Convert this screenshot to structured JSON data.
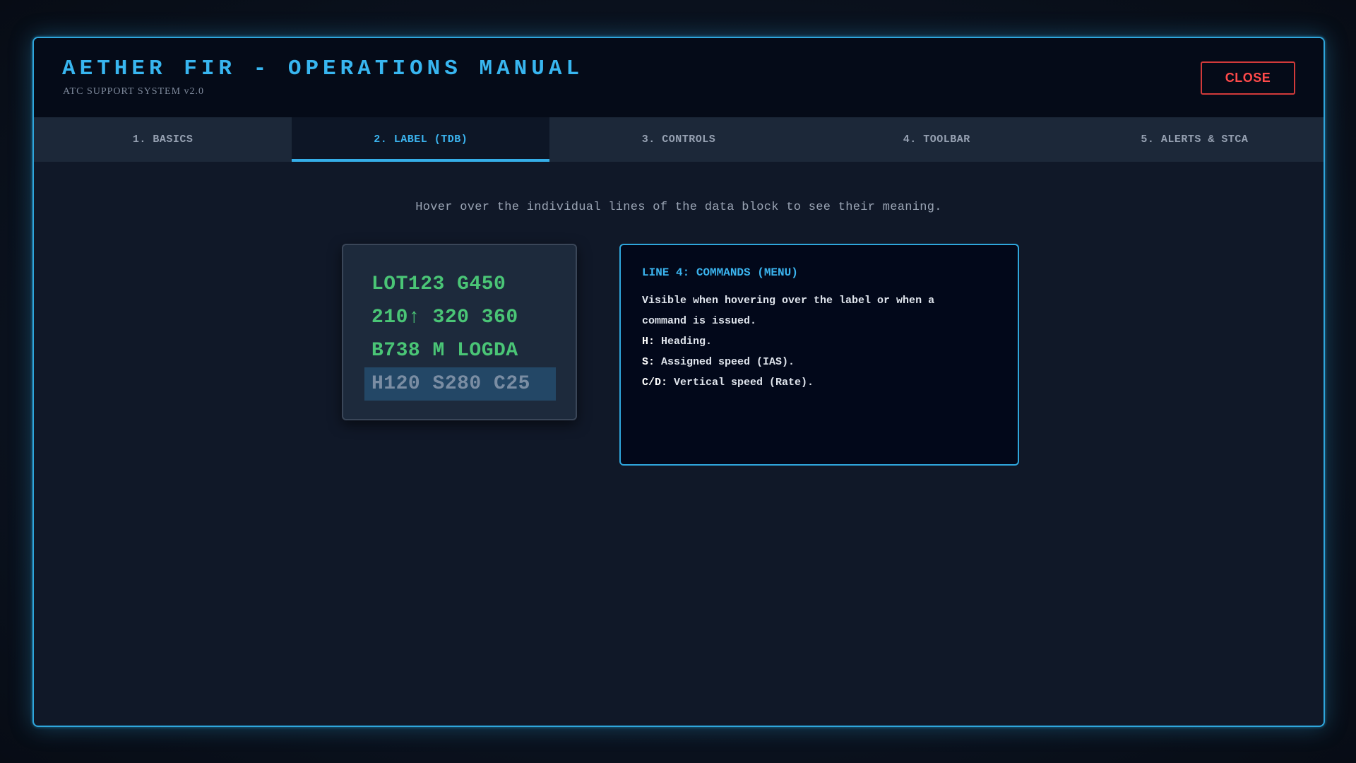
{
  "header": {
    "title": "AETHER FIR - OPERATIONS MANUAL",
    "subtitle": "ATC SUPPORT SYSTEM v2.0",
    "close_label": "CLOSE"
  },
  "tabs": [
    {
      "label": "1. BASICS",
      "active": false
    },
    {
      "label": "2. LABEL (TDB)",
      "active": true
    },
    {
      "label": "3. CONTROLS",
      "active": false
    },
    {
      "label": "4. TOOLBAR",
      "active": false
    },
    {
      "label": "5. ALERTS & STCA",
      "active": false
    }
  ],
  "hint": "Hover over the individual lines of the data block to see their meaning.",
  "datablock": {
    "lines": [
      "LOT123 G450",
      "210↑ 320 360",
      "B738 M LOGDA",
      "H120 S280 C25"
    ],
    "highlighted_line": 4
  },
  "info": {
    "title": "LINE 4: COMMANDS (MENU)",
    "description": "Visible when hovering over the label or when a command is issued.",
    "items": [
      {
        "key": "H:",
        "text": " Heading."
      },
      {
        "key": "S:",
        "text": " Assigned speed (IAS)."
      },
      {
        "key": "C/D:",
        "text": " Vertical speed (Rate)."
      }
    ]
  },
  "colors": {
    "accent": "#38b6f0",
    "close": "#ff4a4a",
    "datablock_text": "#4ac576",
    "highlight_bg": "#234766"
  }
}
